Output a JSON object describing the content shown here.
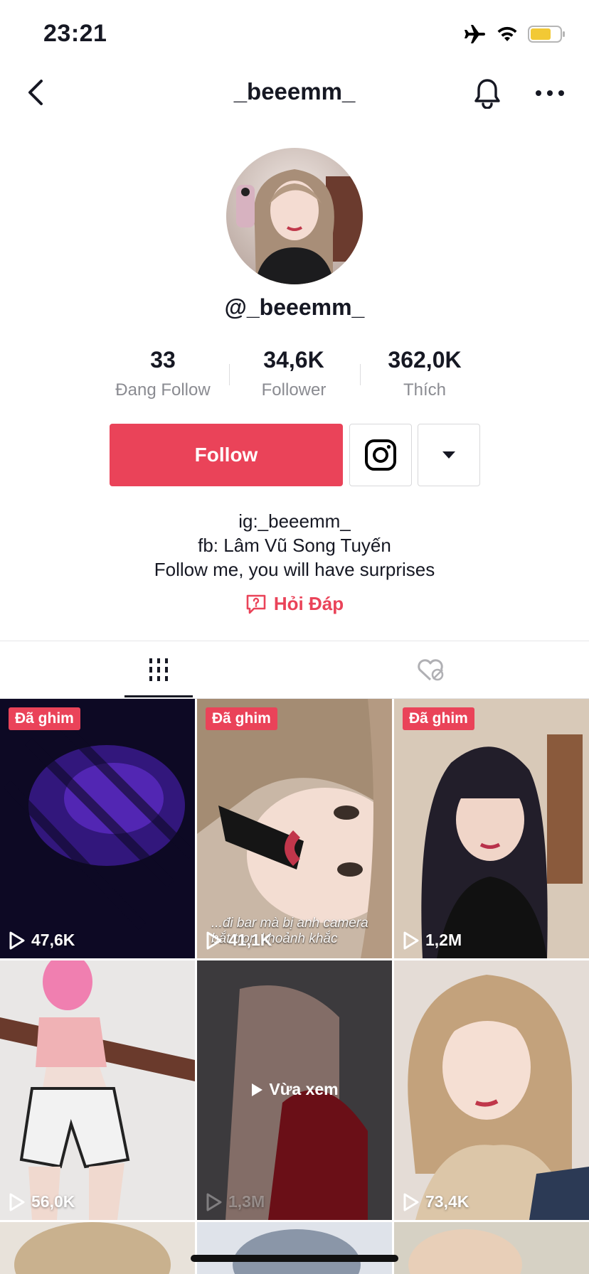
{
  "status_bar": {
    "time": "23:21"
  },
  "nav": {
    "title": "_beeemm_"
  },
  "profile": {
    "handle": "@_beeemm_",
    "stats": [
      {
        "value": "33",
        "label": "Đang Follow"
      },
      {
        "value": "34,6K",
        "label": "Follower"
      },
      {
        "value": "362,0K",
        "label": "Thích"
      }
    ],
    "follow_label": "Follow",
    "bio": [
      "ig:_beeemm_",
      "fb: Lâm Vũ Song Tuyến",
      "Follow me, you will have surprises"
    ],
    "qa_label": "Hỏi Đáp"
  },
  "colors": {
    "accent": "#ea4359",
    "text": "#161823",
    "muted": "#8a8b91"
  },
  "videos": [
    {
      "pinned_label": "Đã ghim",
      "views": "47,6K"
    },
    {
      "pinned_label": "Đã ghim",
      "views": "41,1K",
      "caption": "...đi bar mà bị anh camera bắt trọn khoảnh khắc"
    },
    {
      "pinned_label": "Đã ghim",
      "views": "1,2M"
    },
    {
      "views": "56,0K"
    },
    {
      "views": "1,3M",
      "watched_label": "Vừa xem"
    },
    {
      "views": "73,4K"
    }
  ]
}
